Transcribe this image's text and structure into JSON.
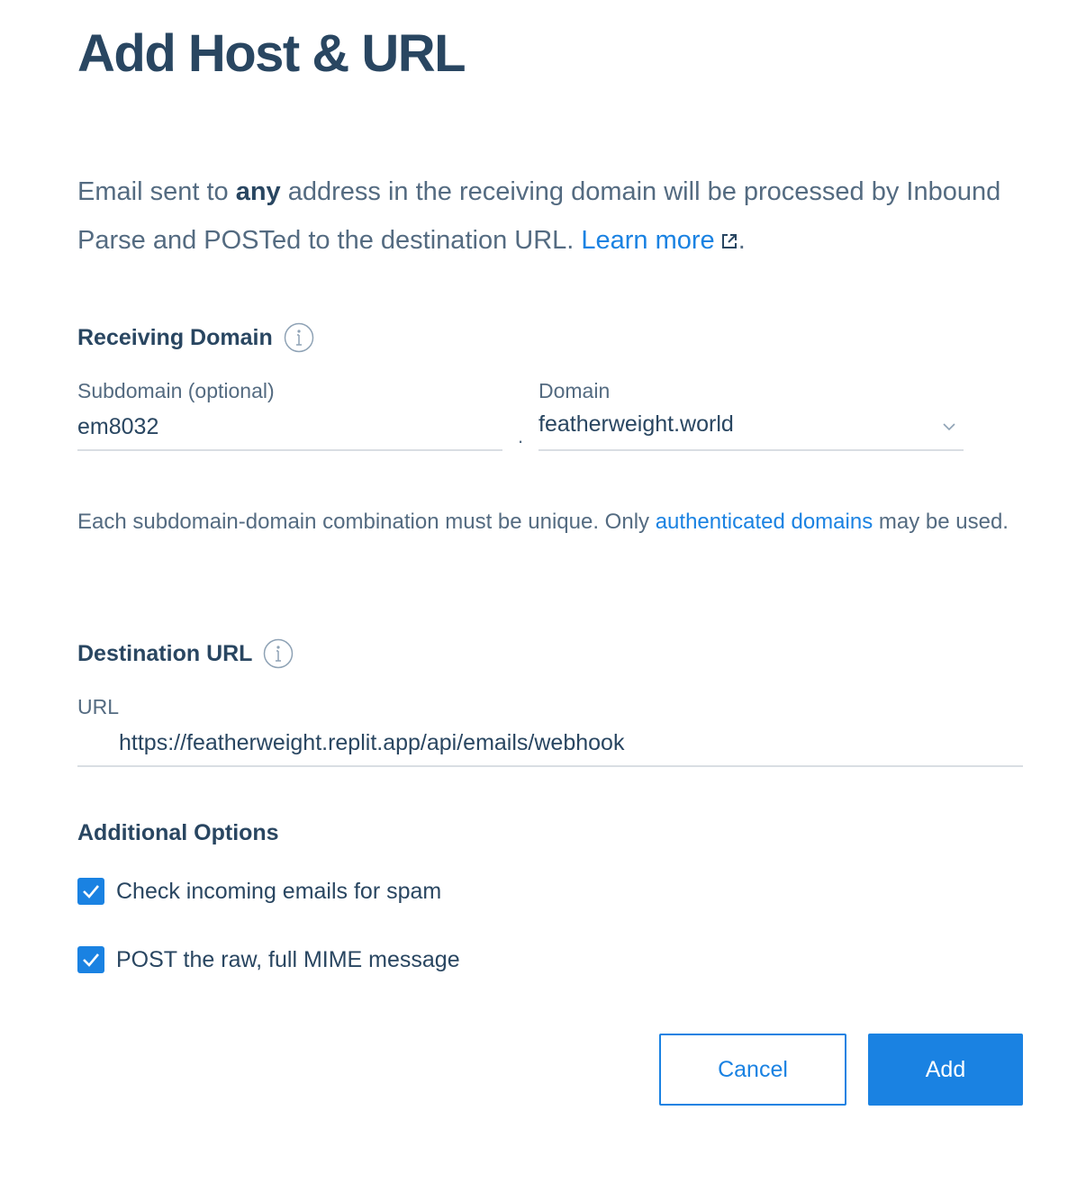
{
  "title": "Add Host & URL",
  "intro": {
    "text_before": "Email sent to ",
    "emphasis": "any",
    "text_after": " address in the receiving domain will be processed by Inbound Parse and POSTed to the destination URL. ",
    "link_label": "Learn more",
    "link_icon": "external-link-icon",
    "trailing": "."
  },
  "receiving_domain": {
    "heading": "Receiving Domain",
    "info_icon": "info-icon",
    "subdomain_label": "Subdomain (optional)",
    "subdomain_value": "em8032",
    "separator": ".",
    "domain_label": "Domain",
    "domain_value": "featherweight.world",
    "note_text": "Each subdomain-domain combination must be unique. Only ",
    "note_link": "authenticated domains",
    "note_after": " may be used."
  },
  "destination_url": {
    "heading": "Destination URL",
    "info_icon": "info-icon",
    "url_label": "URL",
    "url_value": "https://featherweight.replit.app/api/emails/webhook"
  },
  "additional_options": {
    "heading": "Additional Options",
    "options": [
      {
        "label": "Check incoming emails for spam",
        "checked": true
      },
      {
        "label": "POST the raw, full MIME message",
        "checked": true
      }
    ]
  },
  "buttons": {
    "cancel": "Cancel",
    "add": "Add"
  },
  "colors": {
    "heading": "#294661",
    "body_text": "#546b81",
    "accent": "#1a82e2",
    "divider": "#d9dee3"
  }
}
